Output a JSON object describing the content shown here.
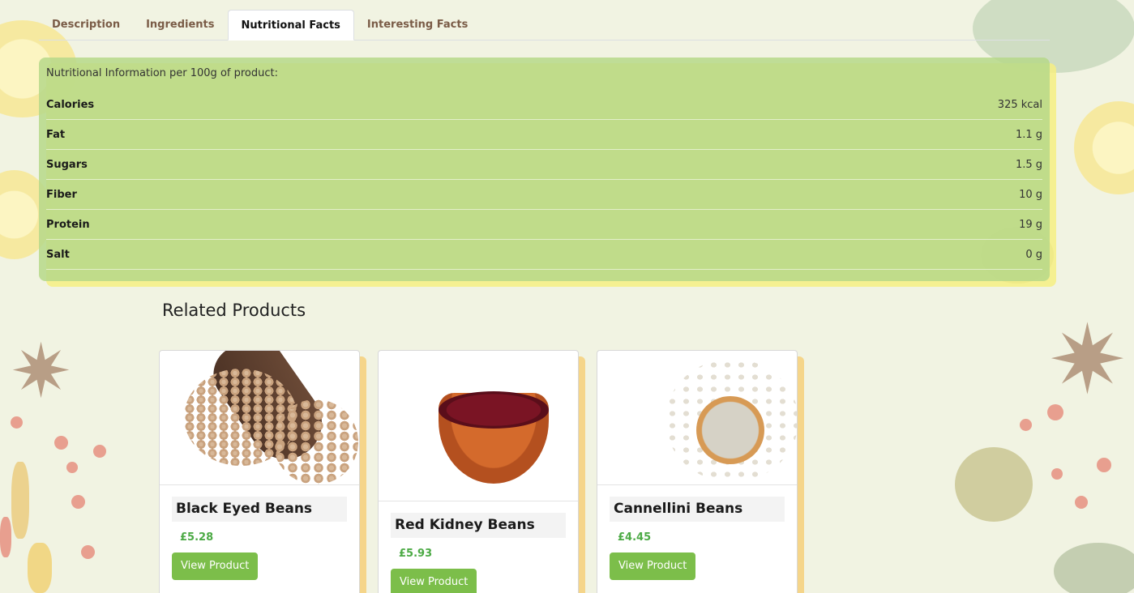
{
  "tabs": [
    {
      "label": "Description",
      "active": false
    },
    {
      "label": "Ingredients",
      "active": false
    },
    {
      "label": "Nutritional Facts",
      "active": true
    },
    {
      "label": "Interesting Facts",
      "active": false
    }
  ],
  "nutrition": {
    "intro": "Nutritional Information per 100g of product:",
    "rows": [
      {
        "label": "Calories",
        "value": "325 kcal"
      },
      {
        "label": "Fat",
        "value": "1.1 g"
      },
      {
        "label": "Sugars",
        "value": "1.5 g"
      },
      {
        "label": "Fiber",
        "value": "10 g"
      },
      {
        "label": "Protein",
        "value": "19 g"
      },
      {
        "label": "Salt",
        "value": "0 g"
      }
    ]
  },
  "related": {
    "title": "Related Products",
    "products": [
      {
        "name": "Black Eyed Beans",
        "price": "£5.28",
        "button": "View Product"
      },
      {
        "name": "Red Kidney Beans",
        "price": "£5.93",
        "button": "View Product"
      },
      {
        "name": "Cannellini Beans",
        "price": "£4.45",
        "button": "View Product"
      }
    ]
  },
  "colors": {
    "panel": "#b7d889",
    "panel_shadow": "#f6ee82",
    "price": "#4caa45",
    "button": "#7cbe4a",
    "tab_text": "#7a5c47"
  },
  "icons": {
    "background": [
      "lemon-slice",
      "star-anise",
      "berry",
      "herb-leaf",
      "seed-pile"
    ]
  }
}
